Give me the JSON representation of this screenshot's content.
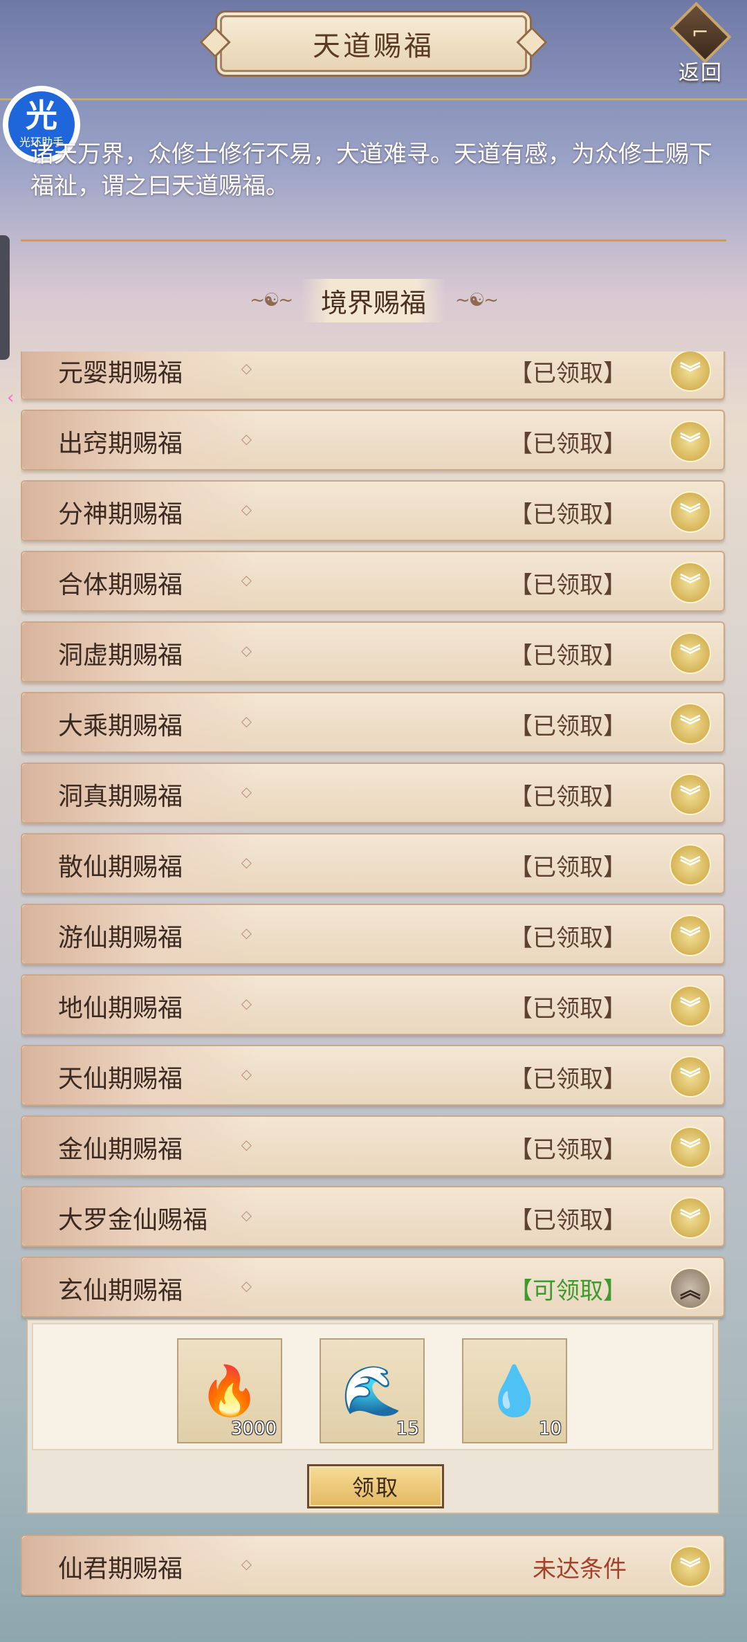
{
  "header": {
    "title": "天道赐福",
    "back_label": "返回"
  },
  "assistant": {
    "glyph": "光",
    "label": "光环助手"
  },
  "intro_text": "诸天万界，众修士修行不易，大道难寻。天道有感，为众修士赐下福祉，谓之曰天道赐福。",
  "section": {
    "title": "境界赐福"
  },
  "rows": [
    {
      "name": "元婴期赐福",
      "status": "【已领取】"
    },
    {
      "name": "出窍期赐福",
      "status": "【已领取】"
    },
    {
      "name": "分神期赐福",
      "status": "【已领取】"
    },
    {
      "name": "合体期赐福",
      "status": "【已领取】"
    },
    {
      "name": "洞虚期赐福",
      "status": "【已领取】"
    },
    {
      "name": "大乘期赐福",
      "status": "【已领取】"
    },
    {
      "name": "洞真期赐福",
      "status": "【已领取】"
    },
    {
      "name": "散仙期赐福",
      "status": "【已领取】"
    },
    {
      "name": "游仙期赐福",
      "status": "【已领取】"
    },
    {
      "name": "地仙期赐福",
      "status": "【已领取】"
    },
    {
      "name": "天仙期赐福",
      "status": "【已领取】"
    },
    {
      "name": "金仙期赐福",
      "status": "【已领取】"
    },
    {
      "name": "大罗金仙赐福",
      "status": "【已领取】"
    },
    {
      "name": "玄仙期赐福",
      "status": "【可领取】"
    },
    {
      "name": "仙君期赐福",
      "status": "未达条件"
    }
  ],
  "expanded": {
    "items": [
      {
        "icon": "fire-icon",
        "glyph": "🔥",
        "count": "3000"
      },
      {
        "icon": "water-swirl-icon",
        "glyph": "🌊",
        "count": "15"
      },
      {
        "icon": "spirit-orb-icon",
        "glyph": "💧",
        "count": "10"
      }
    ],
    "claim_label": "领取"
  },
  "colors": {
    "claimed": "#5d4232",
    "claimable": "#3e9a2e",
    "locked": "#a3412a"
  }
}
